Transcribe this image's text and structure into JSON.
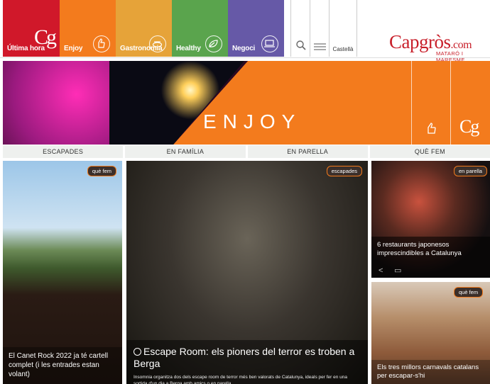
{
  "nav": {
    "categories": [
      {
        "label": "Última hora",
        "color": "#d0182a",
        "icon": "cg-logo"
      },
      {
        "label": "Enjoy",
        "color": "#f37b1d",
        "icon": "thumbs-up-icon"
      },
      {
        "label": "Gastronomia",
        "color": "#e6a339",
        "icon": "plate-icon"
      },
      {
        "label": "Healthy",
        "color": "#5aa44d",
        "icon": "leaf-icon"
      },
      {
        "label": "Negoci",
        "color": "#6659a7",
        "icon": "laptop-icon"
      }
    ],
    "logo_letters": "Cg",
    "language": "Castellà",
    "brand": {
      "name": "Capgròs",
      "suffix": ".com",
      "subtitle": "MATARÓ I MARESME",
      "color": "#c8202b"
    }
  },
  "hero": {
    "title": "ENJOY",
    "logo_letters": "Cg",
    "accent": "#f37b1d"
  },
  "subnav": {
    "items": [
      "ESCAPADES",
      "EN FAMÍLIA",
      "EN PARELLA",
      "QUÈ FEM"
    ]
  },
  "cards": [
    {
      "tag": "què fem",
      "title": "El Canet Rock 2022 ja té cartell complet (i les entrades estan volant)"
    },
    {
      "tag": "escapades",
      "title": "Escape Room: els pioners del terror es troben a Berga",
      "summary": "Insomnia organitza dos dels escape room de terror més ben valorats de Catalunya, ideals per fer en una sortida d'un dia a Berga amb amics o en parella."
    },
    {
      "tag": "en parella",
      "title": "6 restaurants japonesos imprescindibles a Catalunya"
    },
    {
      "tag": "què fem",
      "title": "Els tres millors carnavals catalans per escapar-s'hi"
    }
  ]
}
